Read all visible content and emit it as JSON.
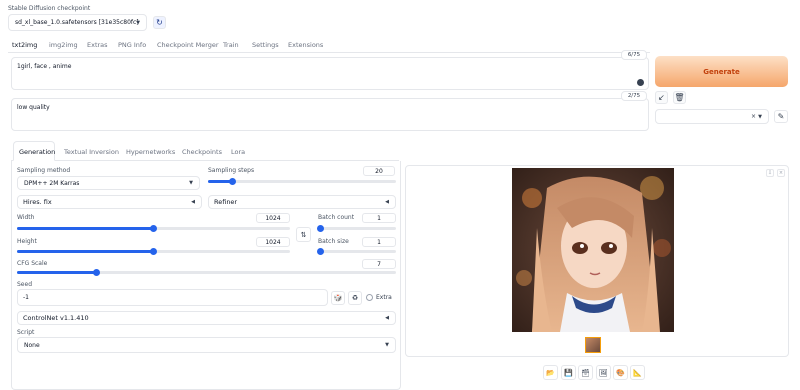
{
  "checkpoint": {
    "label": "Stable Diffusion checkpoint",
    "value": "sd_xl_base_1.0.safetensors [31e35c80fc]"
  },
  "main_tabs": [
    "txt2img",
    "img2img",
    "Extras",
    "PNG Info",
    "Checkpoint Merger",
    "Train",
    "Settings",
    "Extensions"
  ],
  "prompt": {
    "value": "1girl, face , anime",
    "token_count": "6/75"
  },
  "negative_prompt": {
    "value": "low quality",
    "token_count": "2/75"
  },
  "generate": {
    "label": "Generate"
  },
  "sub_tabs": [
    "Generation",
    "Textual Inversion",
    "Hypernetworks",
    "Checkpoints",
    "Lora"
  ],
  "sampling": {
    "method_label": "Sampling method",
    "method_value": "DPM++ 2M Karras",
    "steps_label": "Sampling steps",
    "steps_value": "20",
    "steps_fraction": 0.13
  },
  "accordions": {
    "hires": "Hires. fix",
    "refiner": "Refiner",
    "controlnet": "ControlNet v1.1.410"
  },
  "size": {
    "width_label": "Width",
    "width_value": "1024",
    "width_fraction": 0.5,
    "height_label": "Height",
    "height_value": "1024",
    "height_fraction": 0.5
  },
  "batch": {
    "count_label": "Batch count",
    "count_value": "1",
    "count_fraction": 0.0,
    "size_label": "Batch size",
    "size_value": "1",
    "size_fraction": 0.0
  },
  "cfg": {
    "label": "CFG Scale",
    "value": "7",
    "fraction": 0.21
  },
  "seed": {
    "label": "Seed",
    "value": "-1",
    "extra_label": "Extra"
  },
  "script": {
    "label": "Script",
    "value": "None"
  },
  "colors": {
    "accent": "#2563eb",
    "generate_from": "#fde0c6",
    "generate_to": "#f5a66b",
    "generate_text": "#c2410c"
  }
}
